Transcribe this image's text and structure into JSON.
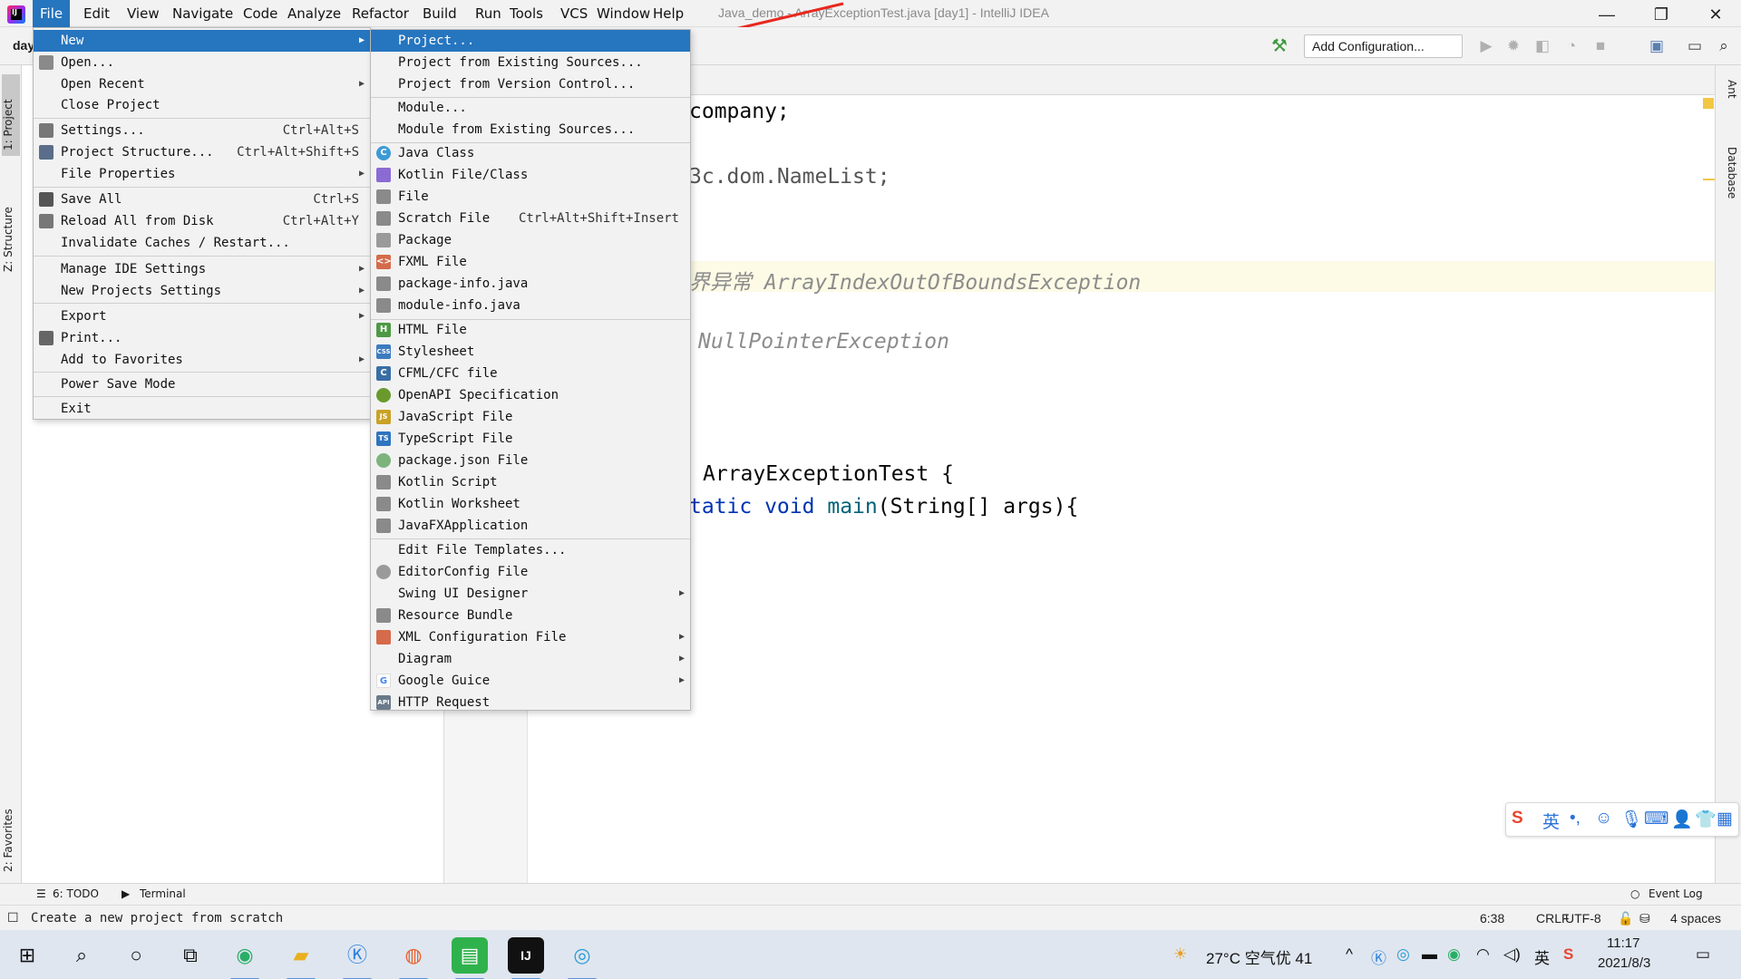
{
  "menubar": {
    "items": [
      "File",
      "Edit",
      "View",
      "Navigate",
      "Code",
      "Analyze",
      "Refactor",
      "Build",
      "Run",
      "Tools",
      "VCS",
      "Window",
      "Help"
    ],
    "window_title": "Java_demo - ArrayExceptionTest.java [day1] - IntelliJ IDEA"
  },
  "window_controls": {
    "minimize": "—",
    "restore": "❐",
    "close": "✕"
  },
  "nav": {
    "crumb": "day",
    "add_configuration": "Add Configuration..."
  },
  "left_strip": {
    "project": "1: Project",
    "structure": "Z: Structure",
    "favorites": "2: Favorites"
  },
  "right_strip": {
    "ant": "Ant",
    "database": "Database"
  },
  "editor": {
    "line1": "company;",
    "line2": "3c.dom.NameList;",
    "line3_comment": "界异常 ArrayIndexOutOfBoundsException",
    "line4_comment": "NullPointerException",
    "line5": "ArrayExceptionTest {",
    "line6_kw": "tatic void",
    "line6_fn": "main",
    "line6_rest": "(String[] args){"
  },
  "file_menu": {
    "items": [
      {
        "label": "New",
        "submenu": true
      },
      {
        "label": "Open..."
      },
      {
        "label": "Open Recent",
        "submenu": true
      },
      {
        "label": "Close Project"
      },
      {
        "label": "Settings...",
        "shortcut": "Ctrl+Alt+S"
      },
      {
        "label": "Project Structure...",
        "shortcut": "Ctrl+Alt+Shift+S"
      },
      {
        "label": "File Properties",
        "submenu": true
      },
      {
        "label": "Save All",
        "shortcut": "Ctrl+S"
      },
      {
        "label": "Reload All from Disk",
        "shortcut": "Ctrl+Alt+Y"
      },
      {
        "label": "Invalidate Caches / Restart..."
      },
      {
        "label": "Manage IDE Settings",
        "submenu": true
      },
      {
        "label": "New Projects Settings",
        "submenu": true
      },
      {
        "label": "Export",
        "submenu": true
      },
      {
        "label": "Print..."
      },
      {
        "label": "Add to Favorites",
        "submenu": true
      },
      {
        "label": "Power Save Mode"
      },
      {
        "label": "Exit"
      }
    ]
  },
  "new_menu": {
    "items": [
      {
        "label": "Project..."
      },
      {
        "label": "Project from Existing Sources..."
      },
      {
        "label": "Project from Version Control..."
      },
      {
        "label": "Module..."
      },
      {
        "label": "Module from Existing Sources..."
      },
      {
        "label": "Java Class"
      },
      {
        "label": "Kotlin File/Class"
      },
      {
        "label": "File"
      },
      {
        "label": "Scratch File",
        "shortcut": "Ctrl+Alt+Shift+Insert"
      },
      {
        "label": "Package"
      },
      {
        "label": "FXML File"
      },
      {
        "label": "package-info.java"
      },
      {
        "label": "module-info.java"
      },
      {
        "label": "HTML File"
      },
      {
        "label": "Stylesheet"
      },
      {
        "label": "CFML/CFC file"
      },
      {
        "label": "OpenAPI Specification"
      },
      {
        "label": "JavaScript File"
      },
      {
        "label": "TypeScript File"
      },
      {
        "label": "package.json File"
      },
      {
        "label": "Kotlin Script"
      },
      {
        "label": "Kotlin Worksheet"
      },
      {
        "label": "JavaFXApplication"
      },
      {
        "label": "Edit File Templates..."
      },
      {
        "label": "EditorConfig File"
      },
      {
        "label": "Swing UI Designer",
        "submenu": true
      },
      {
        "label": "Resource Bundle"
      },
      {
        "label": "XML Configuration File",
        "submenu": true
      },
      {
        "label": "Diagram",
        "submenu": true
      },
      {
        "label": "Google Guice",
        "submenu": true
      },
      {
        "label": "HTTP Request"
      }
    ],
    "icon_badges": {
      "java_class": "C",
      "html": "H",
      "css": "CSS",
      "js": "JS",
      "ts": "TS",
      "cfml": "C",
      "api": "API",
      "fxml": "<>"
    }
  },
  "bottom_tools": {
    "todo": "6: TODO",
    "terminal": "Terminal",
    "event_log": "Event Log"
  },
  "status": {
    "message": "Create a new project from scratch",
    "position": "6:38",
    "line_sep": "CRLF",
    "encoding": "UTF-8",
    "indent": "4 spaces"
  },
  "taskbar": {
    "weather": "27°C 空气优 41",
    "time": "11:17",
    "date": "2021/8/3",
    "ime_lang": "英"
  },
  "colors": {
    "accent": "#2675bf",
    "annotation": "#e8281e"
  }
}
